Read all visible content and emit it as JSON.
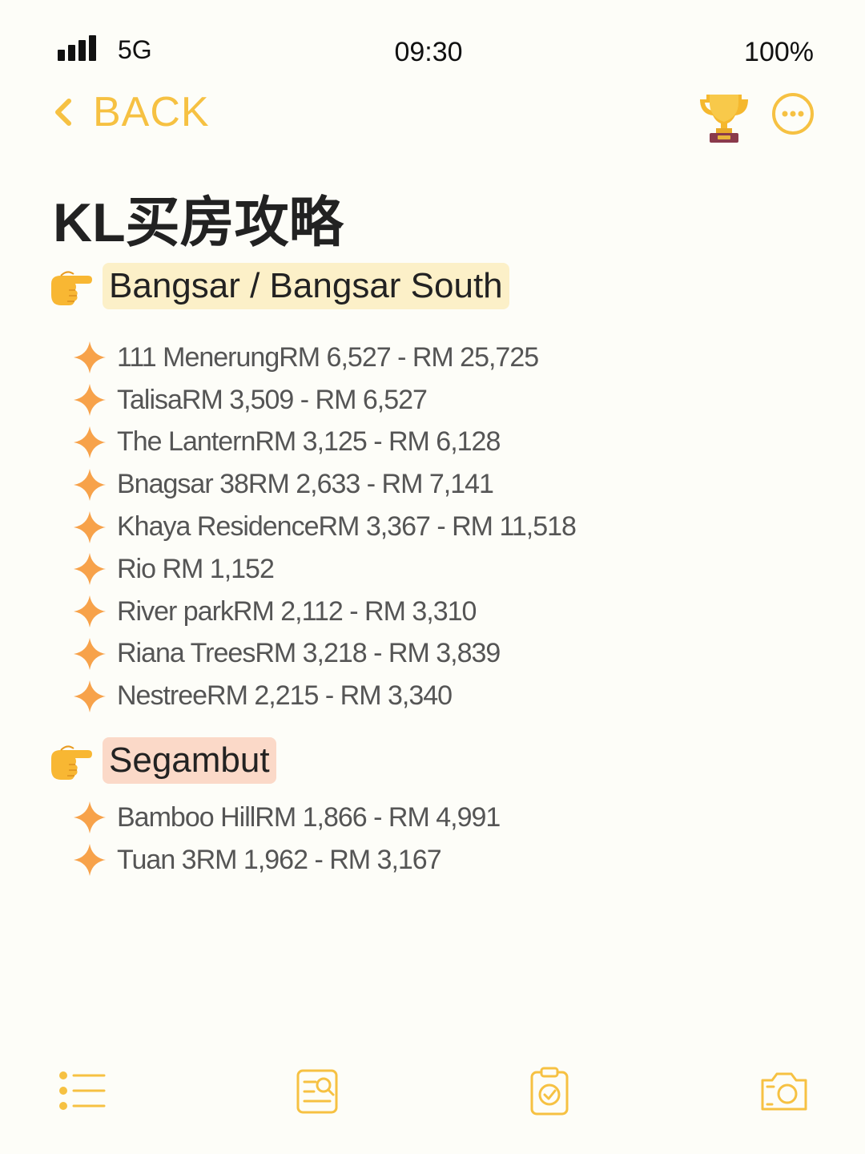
{
  "status_bar": {
    "network": "5G",
    "time": "09:30",
    "battery": "100%"
  },
  "nav": {
    "back_label": "BACK",
    "trophy_icon": "trophy-icon",
    "more_icon": "more-options-icon"
  },
  "page_title": "KL买房攻略",
  "sections": [
    {
      "title": "Bangsar / Bangsar South",
      "items": [
        "111 MenerungRM 6,527 - RM 25,725",
        "TalisaRM 3,509 - RM 6,527",
        "The LanternRM 3,125 - RM 6,128",
        "Bnagsar 38RM 2,633 - RM 7,141",
        "Khaya ResidenceRM 3,367 - RM 11,518",
        "Rio RM 1,152",
        "River parkRM 2,112 - RM 3,310",
        "Riana TreesRM 3,218 - RM 3,839",
        "NestreeRM 2,215 - RM 3,340"
      ]
    },
    {
      "title": "Segambut",
      "items": [
        "Bamboo HillRM 1,866 - RM 4,991",
        "Tuan 3RM 1,962 - RM 3,167"
      ]
    }
  ],
  "toolbar": {
    "icons": [
      "list-icon",
      "search-document-icon",
      "clipboard-check-icon",
      "camera-icon"
    ]
  },
  "colors": {
    "accent": "#f6c142",
    "sparkle": "#f7a24a",
    "highlight_yellow": "#fcf0c8",
    "highlight_peach": "#fbd9c8",
    "background": "#fdfdf8"
  }
}
